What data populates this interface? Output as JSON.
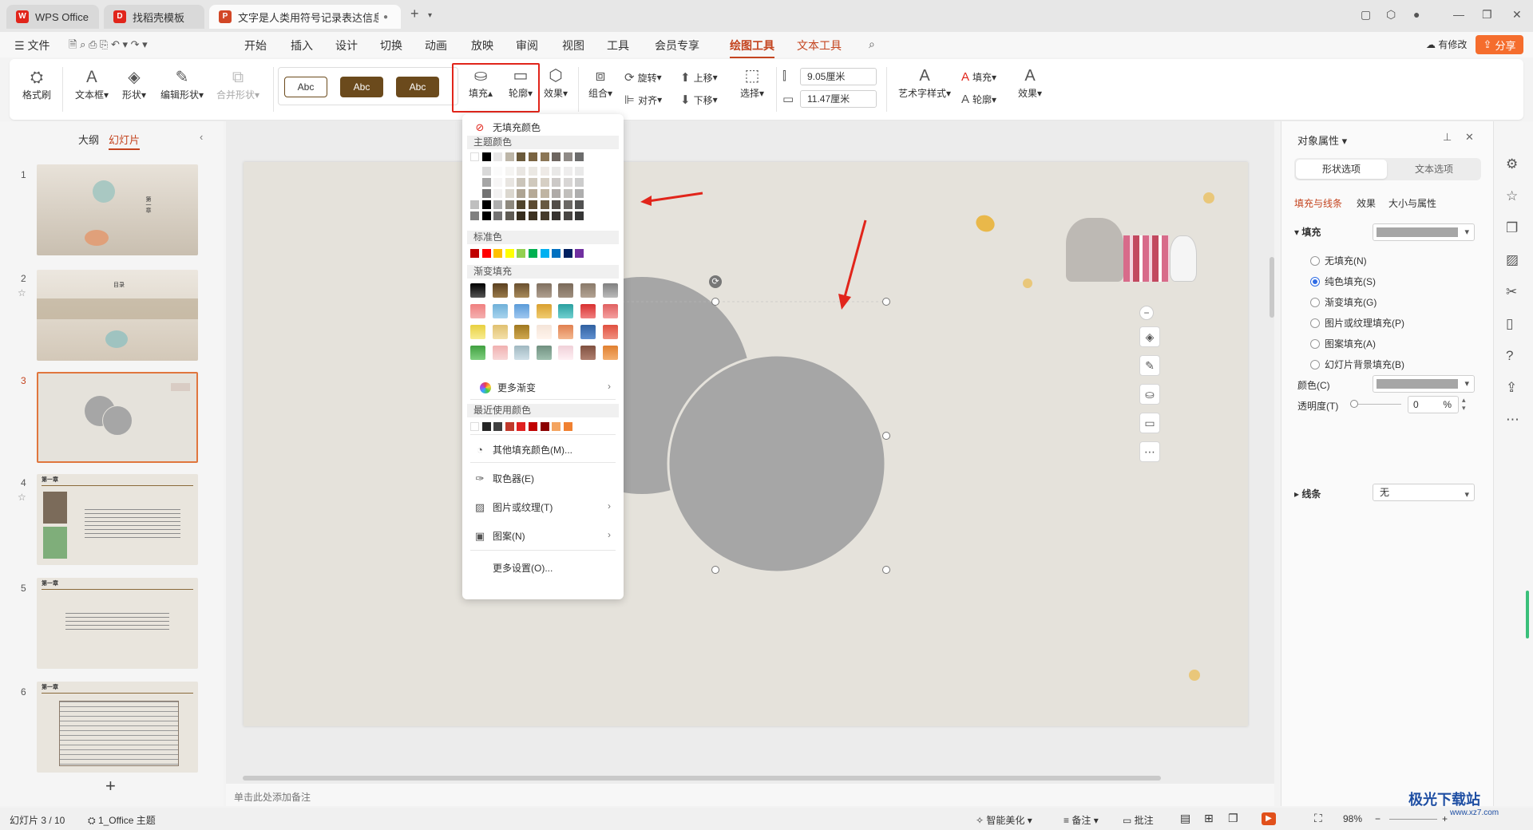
{
  "tabs": [
    {
      "label": "WPS Office"
    },
    {
      "label": "找稻壳模板"
    },
    {
      "label": "文字是人类用符号记录表达信息以"
    }
  ],
  "menu": {
    "file": "文件",
    "items": [
      "开始",
      "插入",
      "设计",
      "切换",
      "动画",
      "放映",
      "审阅",
      "视图",
      "工具",
      "会员专享",
      "绘图工具",
      "文本工具"
    ],
    "modified": "有修改",
    "share": "分享"
  },
  "ribbon": {
    "format_painter": "格式刷",
    "textbox": "文本框",
    "shape": "形状",
    "edit_shape": "编辑形状",
    "merge_shape": "合并形状",
    "style_samples": [
      "Abc",
      "Abc",
      "Abc"
    ],
    "fill": "填充",
    "outline": "轮廓",
    "effect": "效果",
    "group": "组合",
    "align": "对齐",
    "rotate": "旋转",
    "move_up": "上移",
    "move_down": "下移",
    "select": "选择",
    "height": "9.05厘米",
    "width": "11.47厘米",
    "art_style": "艺术字样式",
    "text_fill": "填充",
    "text_outline": "轮廓",
    "text_effect": "效果"
  },
  "left_panel": {
    "tab_outline": "大纲",
    "tab_slides": "幻灯片",
    "slide_numbers": [
      "1",
      "2",
      "3",
      "4",
      "5",
      "6"
    ],
    "slide1_title": "第一章",
    "slide2_title": "目录",
    "chapter_title": "第一章",
    "add_slide": "+"
  },
  "fill_menu": {
    "no_fill": "无填充颜色",
    "theme_colors": "主题颜色",
    "standard_colors": "标准色",
    "gradient_fill": "渐变填充",
    "more_gradient": "更多渐变",
    "recent_colors": "最近使用颜色",
    "other_fill_colors": "其他填充颜色(M)...",
    "eyedropper": "取色器(E)",
    "picture_texture": "图片或纹理(T)",
    "pattern": "图案(N)",
    "more_settings": "更多设置(O)...",
    "theme_top_row": [
      "#ffffff",
      "#000000",
      "#e7e6e6",
      "#bdb6a8",
      "#6b5a3b",
      "#7a6442",
      "#8b7656",
      "#6e6660",
      "#8f8a86",
      "#6c6c6c"
    ],
    "standard_row": [
      "#c00000",
      "#ff0000",
      "#ffc000",
      "#ffff00",
      "#92d050",
      "#00b050",
      "#00b0f0",
      "#0070c0",
      "#002060",
      "#7030a0"
    ],
    "recent_row": [
      "#ffffff",
      "#262626",
      "#404040",
      "#c0392b",
      "#e02020",
      "#c00000",
      "#8b0000",
      "#f4a460",
      "#f08030"
    ]
  },
  "right_panel": {
    "title": "对象属性",
    "tab_shape": "形状选项",
    "tab_text": "文本选项",
    "sub_fill_line": "填充与线条",
    "sub_effect": "效果",
    "sub_size": "大小与属性",
    "fill_label": "填充",
    "options": [
      "无填充(N)",
      "纯色填充(S)",
      "渐变填充(G)",
      "图片或纹理填充(P)",
      "图案填充(A)",
      "幻灯片背景填充(B)"
    ],
    "selected_option": "纯色填充(S)",
    "color_label": "颜色(C)",
    "transparency_label": "透明度(T)",
    "transparency_value": "0",
    "percent": "%",
    "line_label": "线条",
    "line_value": "无",
    "fill_color": "#a6a6a6"
  },
  "notes_placeholder": "单击此处添加备注",
  "status": {
    "slide_count": "幻灯片 3 / 10",
    "theme": "1_Office 主题",
    "smart_beautify": "智能美化",
    "notes": "备注",
    "comments": "批注",
    "zoom": "98%"
  },
  "watermark": "极光下载站",
  "watermark_url": "www.xz7.com",
  "colors": {
    "accent": "#c4441f",
    "share": "#f56d2d",
    "highlight_box": "#e1251b",
    "shape_gray": "#a6a6a6",
    "slide_bg": "#e5e2db"
  }
}
